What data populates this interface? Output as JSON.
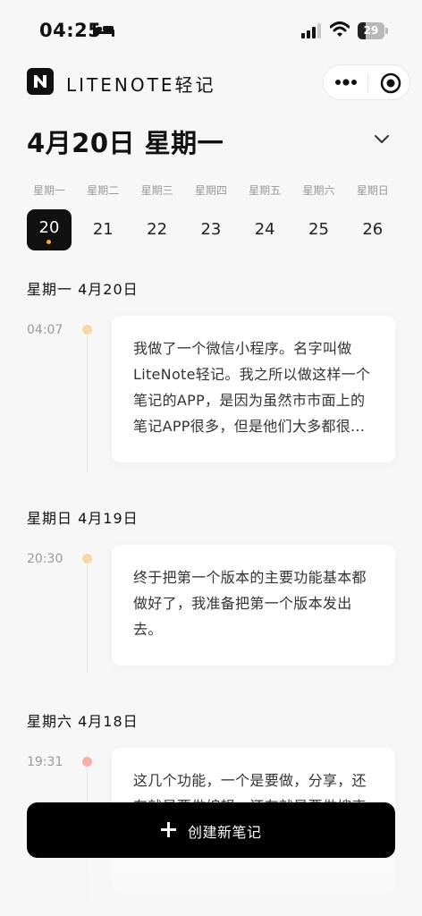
{
  "status_bar": {
    "time": "04:25",
    "battery": "29",
    "battery_level": 0.29,
    "icons": [
      "bed-icon",
      "signal-icon",
      "wifi-icon",
      "battery-icon"
    ]
  },
  "app": {
    "title": "LITENOTE轻记",
    "logo_letter": "N",
    "icons": [
      "more-dots-icon",
      "target-icon"
    ]
  },
  "date_header": {
    "title": "4月20日 星期一",
    "icon": "chevron-down-icon"
  },
  "week": [
    {
      "label": "星期一",
      "day": "20",
      "selected": true,
      "has_note": true
    },
    {
      "label": "星期二",
      "day": "21",
      "selected": false,
      "has_note": false
    },
    {
      "label": "星期三",
      "day": "22",
      "selected": false,
      "has_note": false
    },
    {
      "label": "星期四",
      "day": "23",
      "selected": false,
      "has_note": false
    },
    {
      "label": "星期五",
      "day": "24",
      "selected": false,
      "has_note": false
    },
    {
      "label": "星期六",
      "day": "25",
      "selected": false,
      "has_note": false
    },
    {
      "label": "星期日",
      "day": "26",
      "selected": false,
      "has_note": false
    }
  ],
  "groups": [
    {
      "title": "星期一  4月20日",
      "entries": [
        {
          "time": "04:07",
          "dot_color": "#f9d6a6",
          "text": "我做了一个微信小程序。名字叫做LiteNote轻记。我之所以做这样一个笔记的APP，是因为虽然市市面上的笔记APP很多，但是他们大多都很..."
        }
      ]
    },
    {
      "title": "星期日  4月19日",
      "entries": [
        {
          "time": "20:30",
          "dot_color": "#f9d6a6",
          "text": "终于把第一个版本的主要功能基本都做好了，我准备把第一个版本发出去。"
        }
      ]
    },
    {
      "title": "星期六  4月18日",
      "entries": [
        {
          "time": "19:31",
          "dot_color": "#f6b0a8",
          "text": "这几个功能，一个是要做，分享，还有就是要做编辑，还有就是要做搜索嗯，插入图片，这两个可以做下一..."
        }
      ]
    }
  ],
  "create_button": {
    "label": "创建新笔记",
    "icon": "plus-icon"
  }
}
